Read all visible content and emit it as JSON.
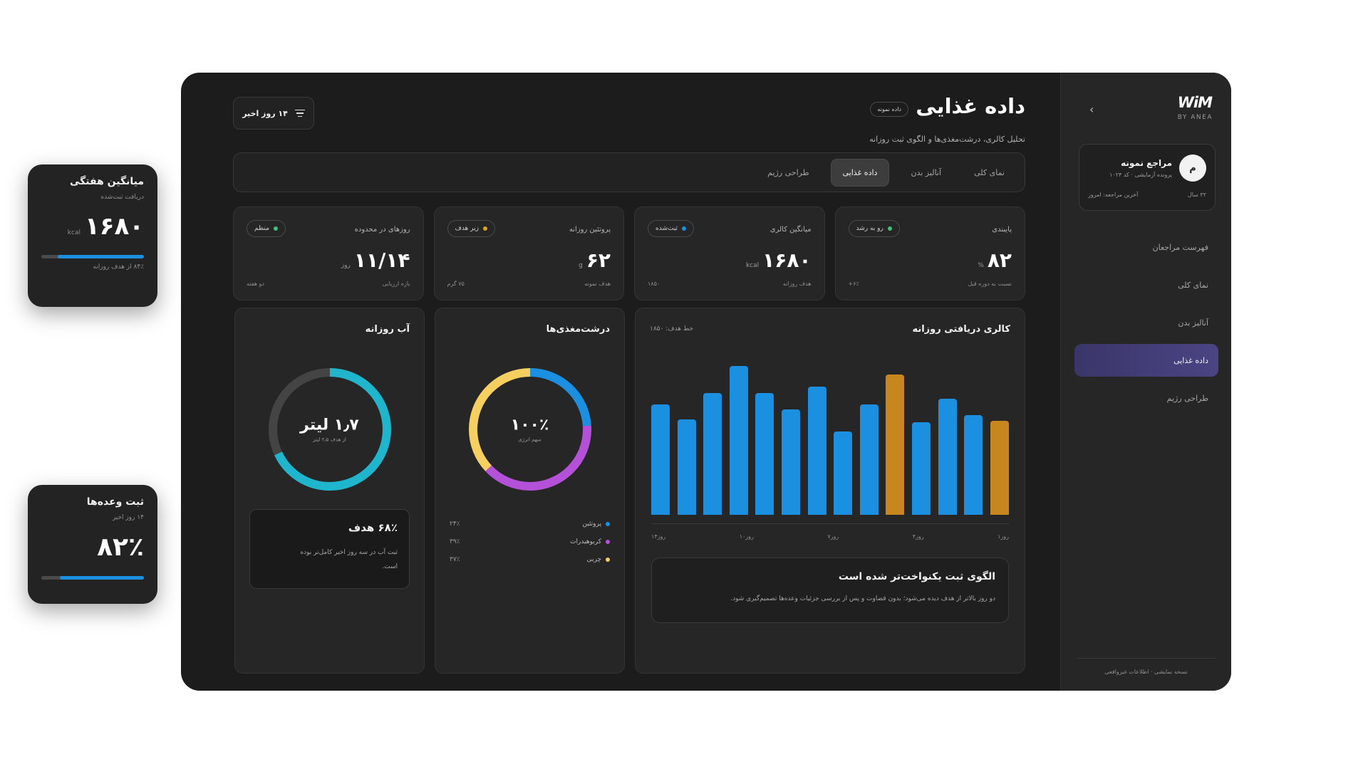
{
  "floating": {
    "weekly": {
      "title": "میانگین هفتگی",
      "subtitle": "دریافت ثبت‌شده",
      "value": "۱۶۸۰",
      "unit": "kcal",
      "progress": 0.84,
      "note": "۸۴٪ از هدف روزانه"
    },
    "meals": {
      "title": "ثبت وعده‌ها",
      "subtitle": "۱۴ روز اخیر",
      "value": "۸۲٪",
      "progress": 0.82
    }
  },
  "sidebar": {
    "logo": "WiM",
    "logo_sub": "BY ANEA",
    "collapse_icon": "chevron-right-icon",
    "client": {
      "avatar": "م",
      "name": "مراجع نمونه",
      "file": "پرونده آزمایشی · کد ۱۰۲۴",
      "age": "۳۲ سال",
      "last_visit": "آخرین مراجعه: امروز"
    },
    "items": [
      {
        "label": "فهرست مراجعان",
        "active": false
      },
      {
        "label": "نمای کلی",
        "active": false
      },
      {
        "label": "آنالیز بدن",
        "active": false
      },
      {
        "label": "داده غذایی",
        "active": true
      },
      {
        "label": "طراحی رژیم",
        "active": false
      }
    ],
    "footer": "نسخه نمایشی · اطلاعات غیرواقعی"
  },
  "header": {
    "title": "داده غذایی",
    "chip": "داده نمونه",
    "subtitle": "تحلیل کالری، درشت‌مغذی‌ها و الگوی ثبت روزانه",
    "filter_label": "۱۴ روز اخیر",
    "filter_icon": "filter-icon"
  },
  "tabs": [
    {
      "label": "نمای کلی",
      "active": false
    },
    {
      "label": "آنالیز بدن",
      "active": false
    },
    {
      "label": "داده غذایی",
      "active": true
    },
    {
      "label": "طراحی رژیم",
      "active": false
    }
  ],
  "stats": [
    {
      "label": "پایبندی",
      "badge": "رو به رشد",
      "badge_color": "#3ec27a",
      "value": "۸۲",
      "unit": "%",
      "foot_right": "نسبت به دوره قبل",
      "foot_left": "۶٪+"
    },
    {
      "label": "میانگین کالری",
      "badge": "ثبت‌شده",
      "badge_color": "#1b8fe0",
      "value": "۱۶۸۰",
      "unit": "kcal",
      "foot_right": "هدف روزانه",
      "foot_left": "۱۸۵۰"
    },
    {
      "label": "پروتئین روزانه",
      "badge": "زیر هدف",
      "badge_color": "#e0a020",
      "value": "۶۲",
      "unit": "g",
      "foot_right": "هدف نمونه",
      "foot_left": "۷۵ گرم"
    },
    {
      "label": "روزهای در محدوده",
      "badge": "منظم",
      "badge_color": "#3ec27a",
      "value": "۱۱/۱۴",
      "unit": "روز",
      "foot_right": "بازه ارزیابی",
      "foot_left": "دو هفته"
    }
  ],
  "calories": {
    "title": "کالری دریافتی روزانه",
    "target_label": "خط هدف: ۱۸۵۰",
    "x_labels": [
      "روز۱",
      "روز۴",
      "روز۷",
      "روز۱۰",
      "روز۱۴"
    ],
    "insight_title": "الگوی ثبت یکنواخت‌تر شده است",
    "insight_text": "دو روز بالاتر از هدف دیده می‌شود؛ بدون قضاوت و پس از بررسی جزئیات وعده‌ها تصمیم‌گیری شود."
  },
  "chart_data": {
    "type": "bar",
    "categories": [
      "1",
      "2",
      "3",
      "4",
      "5",
      "6",
      "7",
      "8",
      "9",
      "10",
      "11",
      "12",
      "13",
      "14"
    ],
    "series": [
      {
        "values": [
          1740,
          1640,
          1820,
          2000,
          1820,
          1710,
          1860,
          1560,
          1740,
          1940,
          1620,
          1780,
          1670,
          1630
        ]
      }
    ],
    "highlight_over_target": [
      false,
      false,
      false,
      false,
      false,
      false,
      false,
      false,
      false,
      true,
      false,
      false,
      false,
      true
    ],
    "target": 1850,
    "ylim": [
      0,
      2100
    ],
    "colors": {
      "normal": "#1b8fe0",
      "over": "#c8861f"
    }
  },
  "macros": {
    "title": "درشت‌مغذی‌ها",
    "center_value": "۱۰۰٪",
    "center_sub": "سهم انرژی",
    "items": [
      {
        "name": "پروتئین",
        "pct": "۲۴٪",
        "share": 24,
        "color": "#1b8fe0"
      },
      {
        "name": "کربوهیدرات",
        "pct": "۳۹٪",
        "share": 39,
        "color": "#b550d8"
      },
      {
        "name": "چربی",
        "pct": "۳۷٪",
        "share": 37,
        "color": "#f5d060"
      }
    ]
  },
  "water": {
    "title": "آب روزانه",
    "center_value": "۱٫۷ لیتر",
    "center_sub": "از هدف ۲٫۵ لیتر",
    "progress": 0.68,
    "color": "#1fb5cc",
    "goal_title": "۶۸٪ هدف",
    "goal_text": "ثبت آب در سه روز اخیر کامل‌تر بوده است."
  }
}
